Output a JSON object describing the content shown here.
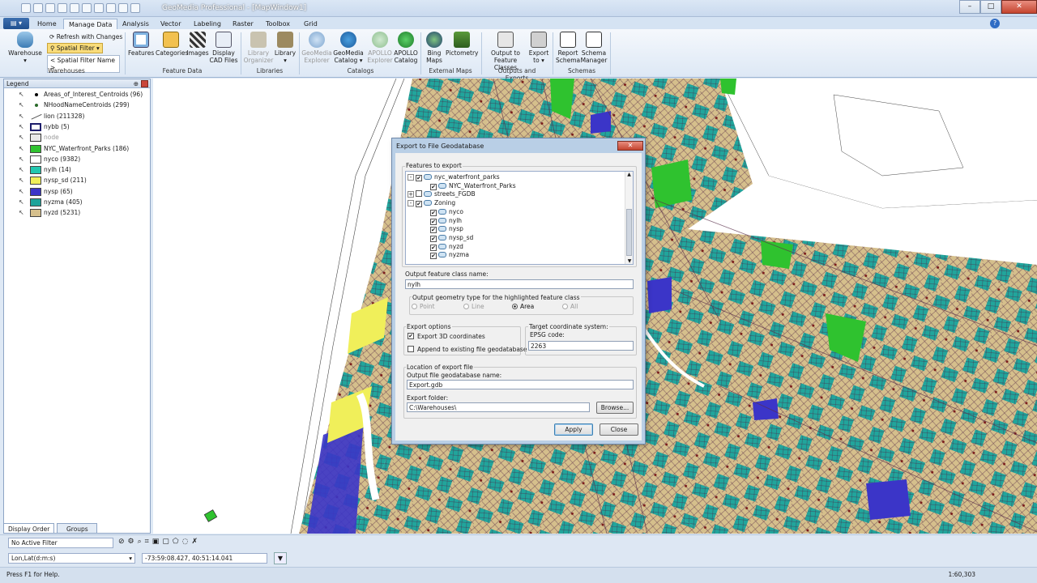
{
  "window": {
    "title": "GeoMedia Professional - [MapWindow1]"
  },
  "tabs": [
    "Home",
    "Manage Data",
    "Analysis",
    "Vector",
    "Labeling",
    "Raster",
    "Toolbox",
    "Grid"
  ],
  "ribbon": {
    "warehouse": "Warehouse",
    "refresh": "Refresh with Changes",
    "spatial_filter": "Spatial Filter",
    "spatial_filter_name": "< Spatial Filter Name >",
    "buttons": [
      "Features",
      "Categories",
      "Images",
      "Display CAD Files",
      "Library Organizer",
      "Library",
      "GeoMedia Explorer",
      "GeoMedia Catalog",
      "APOLLO Explorer",
      "APOLLO Catalog",
      "Bing Maps",
      "Pictometry",
      "Output to Feature Classes",
      "Export to",
      "Report Schema",
      "Schema Manager"
    ],
    "groups": [
      "Warehouses",
      "Feature Data",
      "Libraries",
      "Catalogs",
      "External Maps",
      "Outputs and Exports",
      "Schemas"
    ]
  },
  "legend": {
    "title": "Legend",
    "items": [
      {
        "label": "Areas_of_Interest_Centroids (96)",
        "color": "#000000",
        "kind": "dot"
      },
      {
        "label": "NHoodNameCentroids (299)",
        "color": "#2a6a2a",
        "kind": "dot"
      },
      {
        "label": "lion (211328)",
        "color": "#555555",
        "kind": "line"
      },
      {
        "label": "nybb (5)",
        "color": "#1d1d6b",
        "kind": "outline"
      },
      {
        "label": "node",
        "color": "#777777",
        "kind": "node"
      },
      {
        "label": "NYC_Waterfront_Parks (186)",
        "color": "#2fc22f",
        "kind": "fill"
      },
      {
        "label": "nyco (9382)",
        "color": "#ffffff",
        "kind": "fill"
      },
      {
        "label": "nylh (14)",
        "color": "#22c7b0",
        "kind": "fill"
      },
      {
        "label": "nysp_sd (211)",
        "color": "#f0ef5a",
        "kind": "fill"
      },
      {
        "label": "nysp (65)",
        "color": "#3b35c8",
        "kind": "fill"
      },
      {
        "label": "nyzma (405)",
        "color": "#1fa39a",
        "kind": "fill"
      },
      {
        "label": "nyzd (5231)",
        "color": "#d6c08d",
        "kind": "fill"
      }
    ],
    "tabs": [
      "Display Order",
      "Groups"
    ]
  },
  "status": {
    "filter": "No Active Filter",
    "coord_system": "Lon,Lat(d:m:s)",
    "coords": "-73:59:08.427, 40:51:14.041",
    "help": "Press F1 for Help.",
    "scale": "1:60,303"
  },
  "dialog": {
    "title": "Export to File Geodatabase",
    "features_label": "Features to export",
    "tree": [
      {
        "label": "nyc_waterfront_parks",
        "level": 0,
        "checked": true,
        "expand": "-"
      },
      {
        "label": "NYC_Waterfront_Parks",
        "level": 1,
        "checked": true
      },
      {
        "label": "streets_FGDB",
        "level": 0,
        "checked": false,
        "expand": "+"
      },
      {
        "label": "Zoning",
        "level": 0,
        "checked": true,
        "expand": "-"
      },
      {
        "label": "nyco",
        "level": 1,
        "checked": true
      },
      {
        "label": "nylh",
        "level": 1,
        "checked": true
      },
      {
        "label": "nysp",
        "level": 1,
        "checked": true
      },
      {
        "label": "nysp_sd",
        "level": 1,
        "checked": true
      },
      {
        "label": "nyzd",
        "level": 1,
        "checked": true
      },
      {
        "label": "nyzma",
        "level": 1,
        "checked": true
      }
    ],
    "output_name_label": "Output feature class name:",
    "output_name": "nylh",
    "geom_label": "Output geometry type for the highlighted feature class",
    "geom_options": [
      "Point",
      "Line",
      "Area",
      "All"
    ],
    "geom_selected": "Area",
    "export_options_label": "Export options",
    "export_3d": "Export 3D coordinates",
    "append": "Append to existing file geodatabase",
    "target_label": "Target coordinate system:",
    "epsg_label": "EPSG code:",
    "epsg": "2263",
    "location_label": "Location of export file",
    "gdb_name_label": "Output file geodatabase name:",
    "gdb_name": "Export.gdb",
    "folder_label": "Export folder:",
    "folder": "C:\\Warehouses\\",
    "browse": "Browse...",
    "apply": "Apply",
    "close": "Close"
  }
}
